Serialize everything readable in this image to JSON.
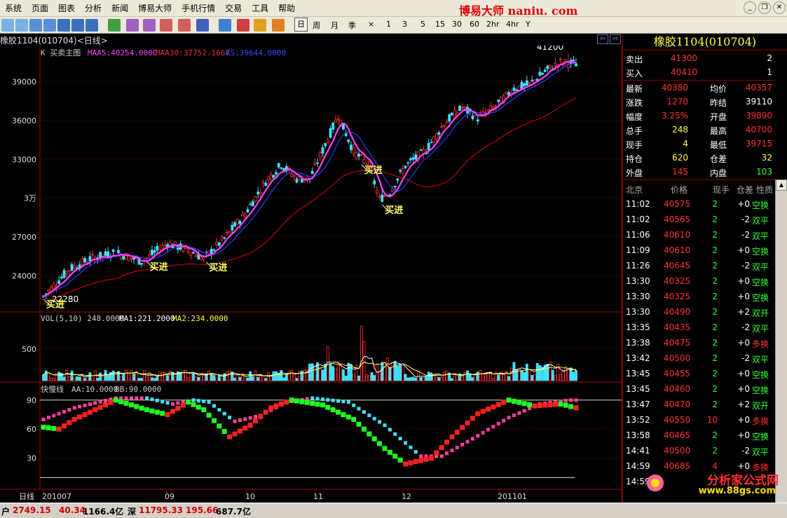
{
  "menu": {
    "items": [
      "系统",
      "页面",
      "图表",
      "分析",
      "新闻",
      "博易大师",
      "手机行情",
      "交易",
      "工具",
      "帮助"
    ],
    "brand": "博易大师 naniu. com"
  },
  "toolbar": {
    "periods": [
      "日",
      "周",
      "月",
      "季",
      "×",
      "1",
      "3",
      "5",
      "15",
      "30",
      "60",
      "2hr",
      "4hr",
      "Y"
    ],
    "active_period": "日"
  },
  "chart_header": {
    "symbol": "橡胶1104(010704)<日线>",
    "main_label": "K  买卖主图",
    "maa5": "MAA5:40254.0000",
    "maa30": "MAA30:37752.1667",
    "ks": "KS:39644.0000",
    "high_label": "41200",
    "low_label": "22280",
    "y_ticks": [
      "39000",
      "36000",
      "33000",
      "3万",
      "27000",
      "24000"
    ],
    "buy_signal": "买进"
  },
  "volume_header": {
    "label": "VOL(5,10) 248.0000",
    "ma1": "MA1:221.2000",
    "ma2": "MA2:234.0000",
    "y_tick": "500"
  },
  "indicator_header": {
    "label": "快慢线",
    "aa": "AA:10.0000",
    "bb": "BB:90.0000",
    "y_ticks": [
      "90",
      "60",
      "30"
    ]
  },
  "x_axis": {
    "period_label": "日线",
    "labels": [
      "201007",
      "09",
      "10",
      "11",
      "12",
      "201101"
    ]
  },
  "quote": {
    "title": "橡胶1104(010704)",
    "sell": {
      "label": "卖出",
      "price": "41300",
      "vol": "2"
    },
    "buy": {
      "label": "买入",
      "price": "40410",
      "vol": "1"
    },
    "rows": [
      {
        "l1": "最新",
        "v1": "40380",
        "l2": "均价",
        "v2": "40357",
        "c1": "#ff3030",
        "c2": "#ff3030"
      },
      {
        "l1": "涨跌",
        "v1": "1270",
        "l2": "昨结",
        "v2": "39110",
        "c1": "#ff3030",
        "c2": "#ffffff"
      },
      {
        "l1": "幅度",
        "v1": "3.25%",
        "l2": "开盘",
        "v2": "39890",
        "c1": "#ff3030",
        "c2": "#ff3030"
      },
      {
        "l1": "总手",
        "v1": "248",
        "l2": "最高",
        "v2": "40700",
        "c1": "#ffff40",
        "c2": "#ff3030"
      },
      {
        "l1": "现手",
        "v1": "4",
        "l2": "最低",
        "v2": "39715",
        "c1": "#ffff40",
        "c2": "#ff3030"
      },
      {
        "l1": "持仓",
        "v1": "620",
        "l2": "仓差",
        "v2": "32",
        "c1": "#ffff40",
        "c2": "#ffff40"
      },
      {
        "l1": "外盘",
        "v1": "145",
        "l2": "内盘",
        "v2": "103",
        "c1": "#ff3030",
        "c2": "#30ff30"
      }
    ],
    "tick_headers": [
      "北京",
      "价格",
      "现手",
      "仓差",
      "性质"
    ],
    "ticks": [
      {
        "time": "11:02",
        "price": "40575",
        "vol": "2",
        "oi": "+0",
        "type": "空换"
      },
      {
        "time": "11:02",
        "price": "40565",
        "vol": "2",
        "oi": "-2",
        "type": "双平"
      },
      {
        "time": "11:06",
        "price": "40610",
        "vol": "2",
        "oi": "-2",
        "type": "双平"
      },
      {
        "time": "11:09",
        "price": "40610",
        "vol": "2",
        "oi": "+0",
        "type": "空换"
      },
      {
        "time": "11:26",
        "price": "40645",
        "vol": "2",
        "oi": "-2",
        "type": "双平"
      },
      {
        "time": "13:30",
        "price": "40325",
        "vol": "2",
        "oi": "+0",
        "type": "空换"
      },
      {
        "time": "13:30",
        "price": "40325",
        "vol": "2",
        "oi": "+0",
        "type": "空换"
      },
      {
        "time": "13:30",
        "price": "40490",
        "vol": "2",
        "oi": "+2",
        "type": "双开"
      },
      {
        "time": "13:35",
        "price": "40435",
        "vol": "2",
        "oi": "-2",
        "type": "双平"
      },
      {
        "time": "13:38",
        "price": "40475",
        "vol": "2",
        "oi": "+0",
        "type": "多换"
      },
      {
        "time": "13:42",
        "price": "40500",
        "vol": "2",
        "oi": "-2",
        "type": "双平"
      },
      {
        "time": "13:45",
        "price": "40455",
        "vol": "2",
        "oi": "+0",
        "type": "空换"
      },
      {
        "time": "13:45",
        "price": "40460",
        "vol": "2",
        "oi": "+0",
        "type": "空换"
      },
      {
        "time": "13:47",
        "price": "40470",
        "vol": "2",
        "oi": "+2",
        "type": "双开"
      },
      {
        "time": "13:52",
        "price": "40550",
        "vol": "10",
        "oi": "+0",
        "type": "多换"
      },
      {
        "time": "13:58",
        "price": "40465",
        "vol": "2",
        "oi": "+0",
        "type": "空换"
      },
      {
        "time": "14:41",
        "price": "40500",
        "vol": "2",
        "oi": "-2",
        "type": "双平"
      },
      {
        "time": "14:59",
        "price": "40685",
        "vol": "4",
        "oi": "+0",
        "type": "多换"
      },
      {
        "time": "14:59",
        "price": "",
        "vol": "",
        "oi": "",
        "type": ""
      }
    ],
    "logo_text": "分析家公式网",
    "logo_url": "www.88gs.com"
  },
  "status": {
    "label1": "户",
    "v1": "2749.15",
    "v2": "40.34",
    "v3": "1166.4亿",
    "label2": "深",
    "v4": "11795.33",
    "v5": "195.66",
    "v6": "687.7亿"
  },
  "colors": {
    "up": "#ff3030",
    "down": "#40e0ff",
    "maa5": "#ff40ff",
    "maa30": "#c00000",
    "ks": "#2040ff",
    "grid": "#800000"
  }
}
